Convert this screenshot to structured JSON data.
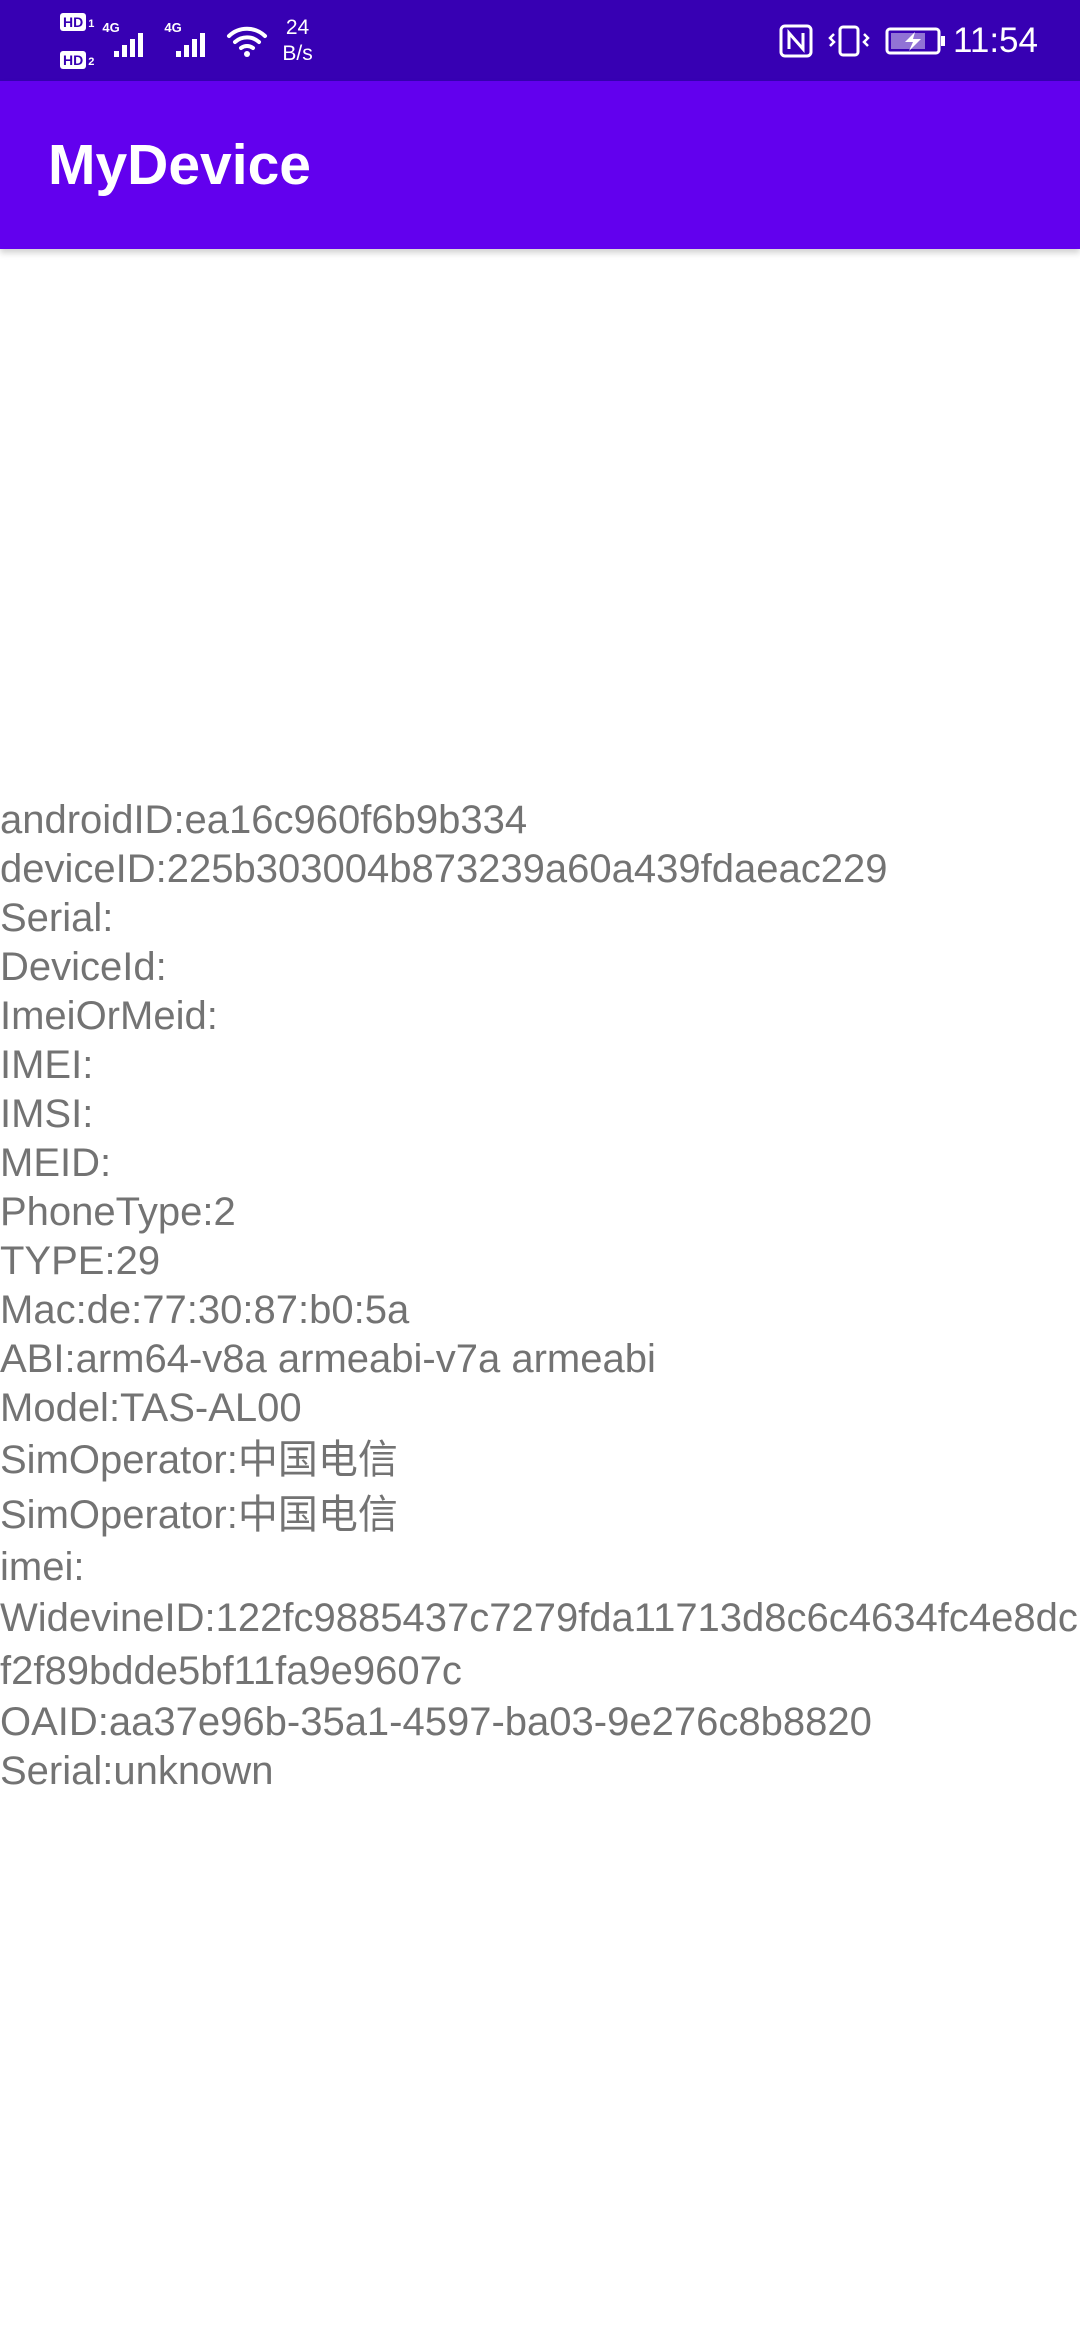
{
  "status_bar": {
    "hd1": "HD",
    "hd1_num": "1",
    "hd2": "HD",
    "hd2_num": "2",
    "sim1_network": "4G",
    "sim2_network": "4G",
    "speed_value": "24",
    "speed_unit": "B/s",
    "time": "11:54",
    "icons": [
      "hd-icon",
      "signal-icon",
      "wifi-icon",
      "nfc-icon",
      "vibrate-icon",
      "battery-charging-icon"
    ]
  },
  "app_bar": {
    "title": "MyDevice",
    "color": "#6200ee",
    "status_color": "#3700b3"
  },
  "info_lines": [
    "androidID:ea16c960f6b9b334",
    "deviceID:225b303004b873239a60a439fdaeac229",
    "Serial:",
    "DeviceId:",
    "ImeiOrMeid:",
    "IMEI:",
    "IMSI:",
    "MEID:",
    "PhoneType:2",
    "TYPE:29",
    "Mac:de:77:30:87:b0:5a",
    "ABI:arm64-v8a armeabi-v7a armeabi",
    "Model:TAS-AL00",
    "SimOperator:中国电信",
    "SimOperator:中国电信",
    "imei:",
    "WidevineID:122fc9885437c7279fda11713d8c6c4634fc4e8dcf2f89bdde5bf11fa9e9607c",
    "OAID:aa37e96b-35a1-4597-ba03-9e276c8b8820",
    "Serial:unknown"
  ]
}
